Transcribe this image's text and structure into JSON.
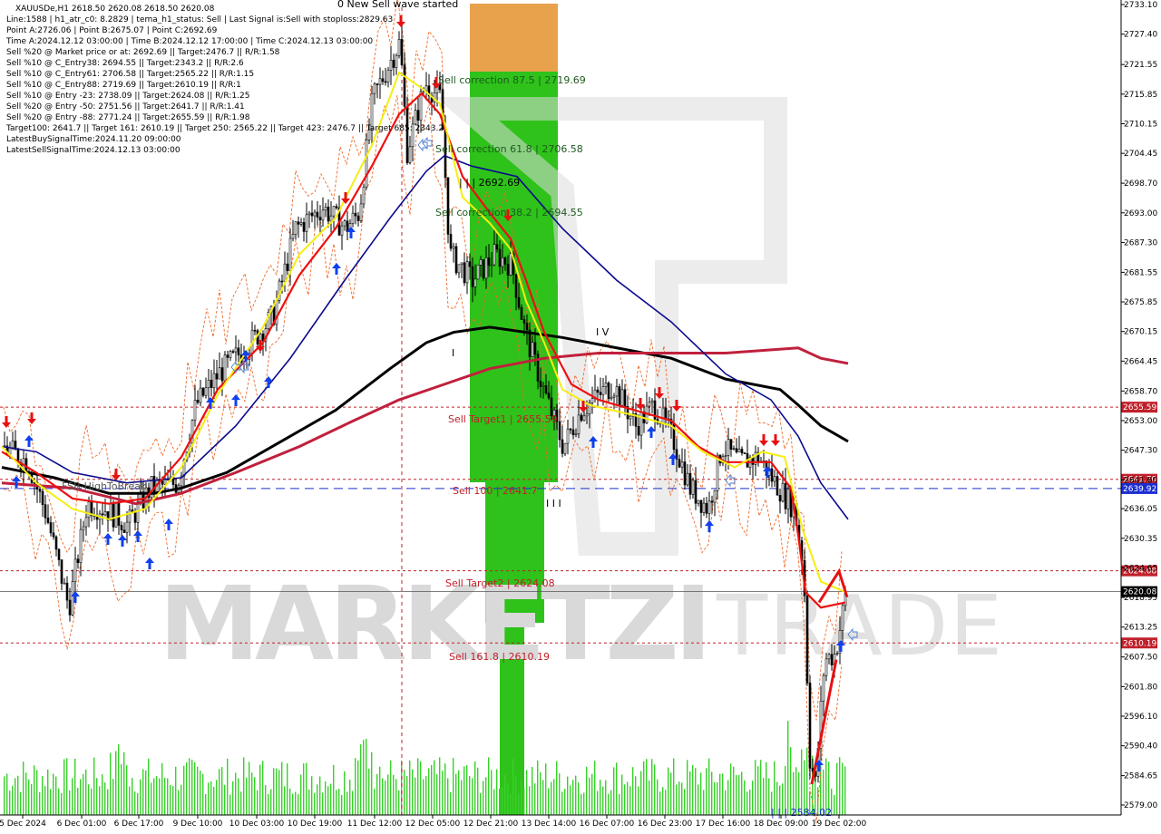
{
  "header": {
    "symbol_line": "XAUUSDe,H1  2618.50 2620.08 2618.50 2620.08",
    "new_sell_wave": "0 New Sell wave started"
  },
  "info_lines": [
    "Line:1588  |  h1_atr_c0: 8.2829  |  tema_h1_status: Sell  |  Last Signal is:Sell with stoploss:2829.63",
    "Point A:2726.06  |  Point B:2675.07  |  Point C:2692.69",
    "Time A:2024.12.12 03:00:00  |  Time B:2024.12.12 17:00:00  |  Time C:2024.12.13 03:00:00",
    "Sell %20 @ Market price or at: 2692.69  ||  Target:2476.7  ||  R/R:1.58",
    "Sell %10 @ C_Entry38: 2694.55  ||  Target:2343.2  ||  R/R:2.6",
    "Sell %10 @ C_Entry61: 2706.58  ||  Target:2565.22  ||  R/R:1.15",
    "Sell %10 @ C_Entry88: 2719.69  ||  Target:2610.19  ||  R/R:1",
    "Sell %10 @ Entry -23: 2738.09  ||  Target:2624.08  ||  R/R:1.25",
    "Sell %20 @ Entry -50: 2751.56  ||  Target:2641.7  ||  R/R:1.41",
    "Sell %20 @ Entry -88: 2771.24  ||  Target:2655.59  ||  R/R:1.98",
    "Target100: 2641.7  ||  Target 161: 2610.19  ||  Target 250: 2565.22  ||  Target 423: 2476.7  ||  Target 685: 2343.2",
    "LatestBuySignalTime:2024.11.20 09:00:00",
    "LatestSellSignalTime:2024.12.13 03:00:00"
  ],
  "watermark": {
    "text_bold": "MARKETZI",
    "text_light": "TRADE"
  },
  "chart_data": {
    "type": "candlestick",
    "symbol": "XAUUSDe",
    "timeframe": "H1",
    "ylim": [
      2579.0,
      2734.0
    ],
    "y_ticks": [
      "2733.10",
      "2727.40",
      "2721.55",
      "2715.85",
      "2710.15",
      "2704.45",
      "2698.70",
      "2693.00",
      "2687.30",
      "2681.55",
      "2675.85",
      "2670.15",
      "2664.45",
      "2658.70",
      "2653.00",
      "2647.30",
      "2641.60",
      "2636.05",
      "2630.35",
      "2624.65",
      "2618.95",
      "2613.25",
      "2607.50",
      "2601.80",
      "2596.10",
      "2590.40",
      "2584.65",
      "2579.00"
    ],
    "x_labels": [
      "5 Dec 2024",
      "6 Dec 01:00",
      "6 Dec 17:00",
      "9 Dec 10:00",
      "10 Dec 03:00",
      "10 Dec 19:00",
      "11 Dec 12:00",
      "12 Dec 05:00",
      "12 Dec 21:00",
      "13 Dec 14:00",
      "16 Dec 07:00",
      "16 Dec 23:00",
      "17 Dec 16:00",
      "18 Dec 09:00",
      "19 Dec 02:00"
    ],
    "current_price": "2620.08",
    "level_tags": [
      {
        "value": "2655.59",
        "color": "#c0202a"
      },
      {
        "value": "2641.70",
        "color": "#c0202a"
      },
      {
        "value": "2639.92",
        "color": "#1a2ed0"
      },
      {
        "value": "2624.08",
        "color": "#c0202a"
      },
      {
        "value": "2620.08",
        "color": "#000000"
      },
      {
        "value": "2610.19",
        "color": "#c0202a"
      }
    ],
    "level_labels": {
      "sell_correction_875": "Sell correction 87.5 | 2719.69",
      "sell_correction_618": "Sell correction 61.8 | 2706.58",
      "sell_correction_382": "Sell correction 38.2 | 2694.55",
      "point_c": "| | | 2692.69",
      "sell_target1": "Sell Target1 | 2655.59",
      "sell_100": "Sell 100 | 2641.7",
      "sell_target2": "Sell Target2 | 2624.08",
      "sell_1618": "Sell 161.8 | 2610.19",
      "low_label": "| | | 2584.02",
      "wave_iv": "I V",
      "wave_iii": "I I I",
      "wave_i": "I",
      "fsb": "FSB-HighToBreak"
    },
    "colors": {
      "sell_level": "#c0202a",
      "buy_level": "#1a2ed0",
      "zone_orange": "#e8a24c",
      "zone_green": "#2ec21a",
      "bull_candle": "#ffffff",
      "bear_candle": "#000000",
      "volume": "#38d12a",
      "ma_black": "#000000",
      "ma_crimson": "#c0203c",
      "ma_navy": "#0a0a8c",
      "ma_red": "#ee1010",
      "ma_yellow": "#f5ee10",
      "band_orange": "#ee6a2a",
      "buy_arrow": "#1040f0",
      "sell_arrow": "#e81010"
    }
  }
}
